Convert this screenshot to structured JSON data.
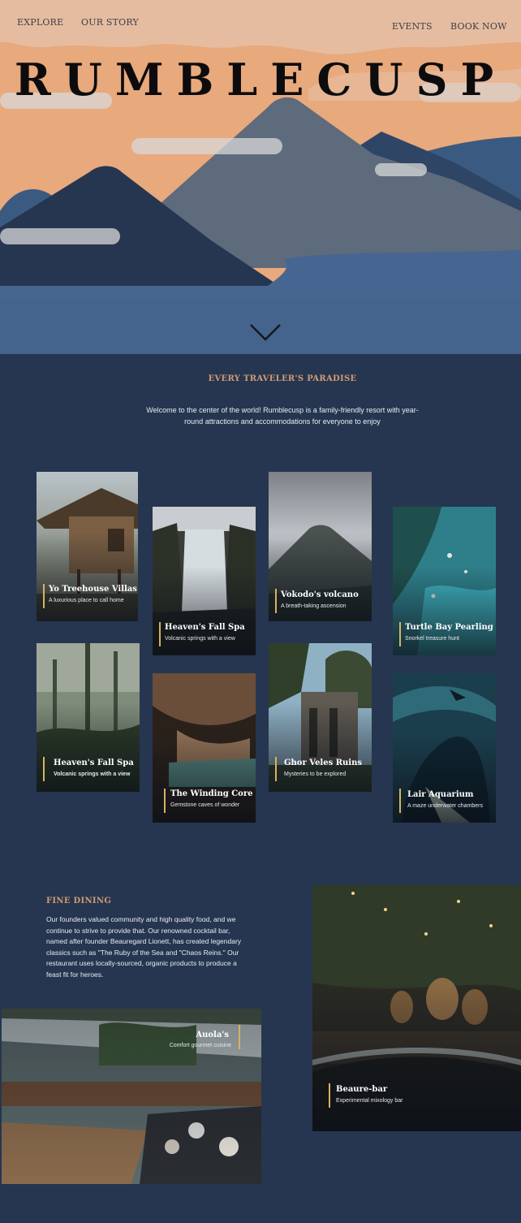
{
  "nav": {
    "left": [
      "EXPLORE",
      "OUR STORY"
    ],
    "right": [
      "EVENTS",
      "BOOK NOW"
    ]
  },
  "brand": "RUMBLECUSP",
  "intro": {
    "title": "EVERY TRAVELER'S PARADISE",
    "text": "Welcome to the center of the world! Rumblecusp is a family-friendly resort with year-round attractions and accommodations for everyone to enjoy"
  },
  "attractions": [
    {
      "title": "Yo Treehouse Villas",
      "subtitle": "A luxurious place to call home"
    },
    {
      "title": "Heaven's Fall Spa",
      "subtitle": "Volcanic springs with a view"
    },
    {
      "title": "Vokodo's volcano",
      "subtitle": "A breath-taking ascension"
    },
    {
      "title": "Turtle Bay Pearling",
      "subtitle": "Snorkel treasure hunt"
    },
    {
      "title": "Heaven's Fall Spa",
      "subtitle": "Volcanic springs with a view"
    },
    {
      "title": "The Winding Core",
      "subtitle": "Gemstone caves of wonder"
    },
    {
      "title": "Ghor Veles Ruins",
      "subtitle": "Mysteries to be explored"
    },
    {
      "title": "Lair Aquarium",
      "subtitle": "A maze underwater chambers"
    }
  ],
  "dining": {
    "title": "FINE DINING",
    "text": "Our founders valued community and high quality food, and we continue to strive to provide that. Our renowned cocktail bar, named after founder Beauregard Lionett, has created legendary classics such as \"The Ruby of the Sea and \"Chaos Reins.\" Our restaurant uses locally-sourced, organic products to produce a feast fit for heroes.",
    "venues": [
      {
        "title": "Beaure-bar",
        "subtitle": "Experimental mixology bar"
      },
      {
        "title": "Auola's",
        "subtitle": "Comfort gourmet cuisine"
      }
    ]
  },
  "colors": {
    "page_bg": "#263650",
    "sky": "#e8a97c",
    "accent_title": "#cf9c72",
    "card_bar": "#d9b25f"
  }
}
